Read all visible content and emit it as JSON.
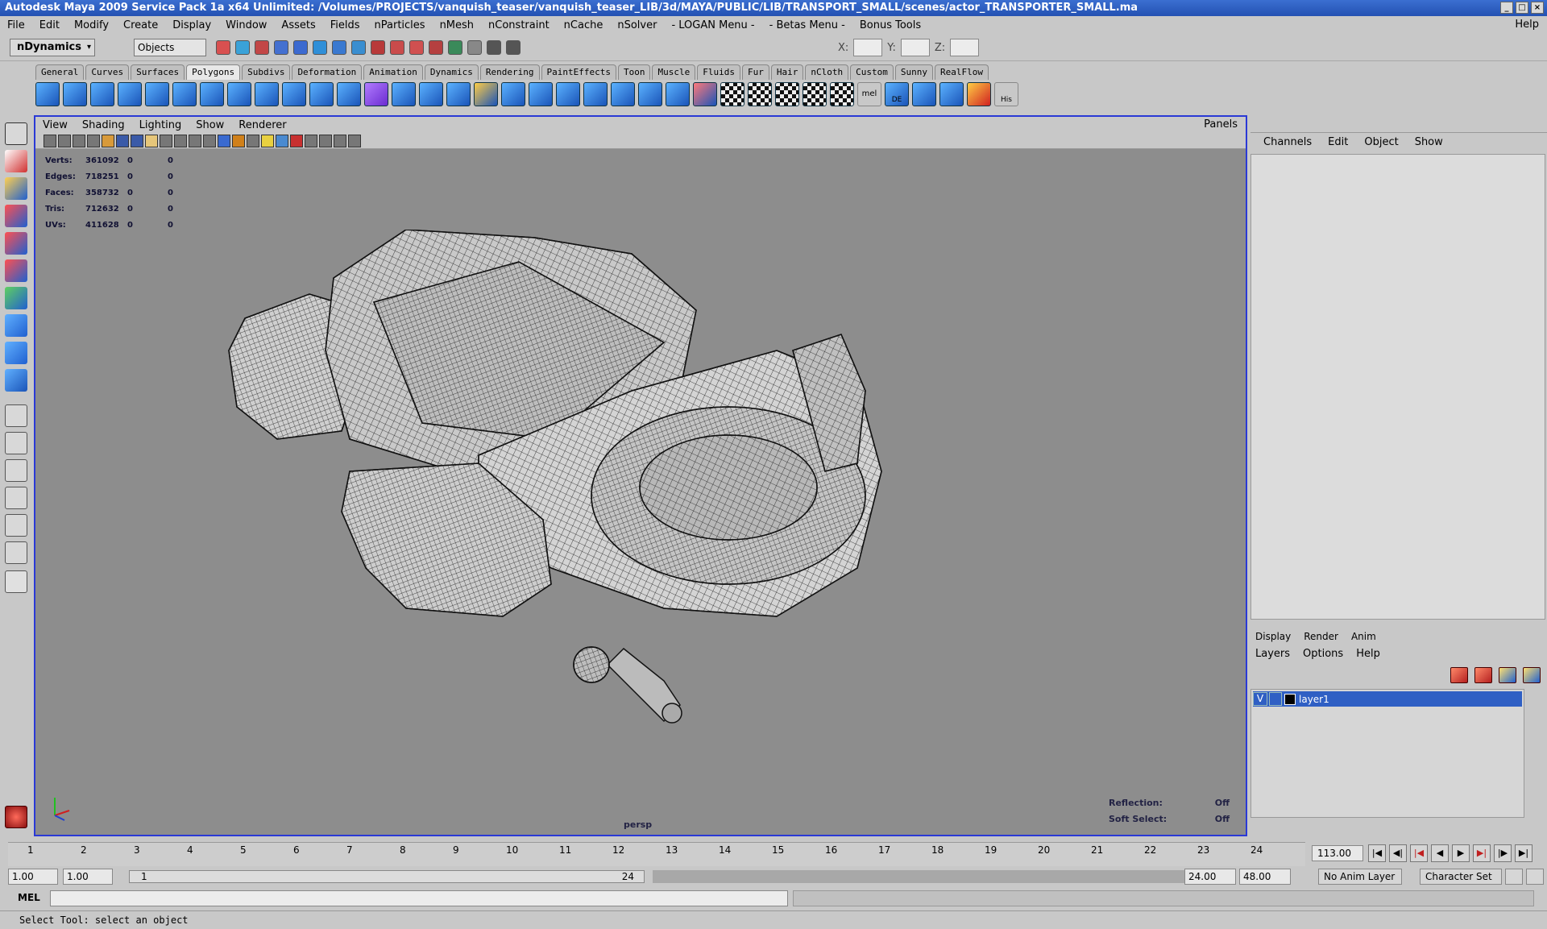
{
  "window": {
    "title": "Autodesk Maya 2009 Service Pack 1a x64 Unlimited: /Volumes/PROJECTS/vanquish_teaser/vanquish_teaser_LIB/3d/MAYA/PUBLIC/LIB/TRANSPORT_SMALL/scenes/actor_TRANSPORTER_SMALL.ma"
  },
  "menubar": {
    "items": [
      "File",
      "Edit",
      "Modify",
      "Create",
      "Display",
      "Window",
      "Assets",
      "Fields",
      "nParticles",
      "nMesh",
      "nConstraint",
      "nCache",
      "nSolver",
      "- LOGAN Menu -",
      "- Betas Menu -",
      "Bonus Tools"
    ],
    "help": "Help"
  },
  "status": {
    "mode": "nDynamics",
    "selection_mask": "Objects",
    "x_label": "X:",
    "y_label": "Y:",
    "z_label": "Z:"
  },
  "shelf": {
    "tabs": [
      "General",
      "Curves",
      "Surfaces",
      "Polygons",
      "Subdivs",
      "Deformation",
      "Animation",
      "Dynamics",
      "Rendering",
      "PaintEffects",
      "Toon",
      "Muscle",
      "Fluids",
      "Fur",
      "Hair",
      "nCloth",
      "Custom",
      "Sunny",
      "RealFlow"
    ],
    "active": "Polygons",
    "labels": {
      "mel": "mel",
      "de": "DE",
      "his": "His"
    }
  },
  "viewport": {
    "menu": [
      "View",
      "Shading",
      "Lighting",
      "Show",
      "Renderer"
    ],
    "panels": "Panels",
    "camera": "persp",
    "hud": [
      {
        "label": "Verts:",
        "value": "361092",
        "a": "0",
        "b": "0"
      },
      {
        "label": "Edges:",
        "value": "718251",
        "a": "0",
        "b": "0"
      },
      {
        "label": "Faces:",
        "value": "358732",
        "a": "0",
        "b": "0"
      },
      {
        "label": "Tris:",
        "value": "712632",
        "a": "0",
        "b": "0"
      },
      {
        "label": "UVs:",
        "value": "411628",
        "a": "0",
        "b": "0"
      }
    ],
    "hud_right": [
      {
        "label": "Reflection:",
        "value": "Off"
      },
      {
        "label": "Soft Select:",
        "value": "Off"
      }
    ]
  },
  "channelbox": {
    "menu": [
      "Channels",
      "Edit",
      "Object",
      "Show"
    ]
  },
  "layers": {
    "tabs": [
      "Display",
      "Render",
      "Anim"
    ],
    "menu": [
      "Layers",
      "Options",
      "Help"
    ],
    "row": {
      "visible": "V",
      "name": "layer1"
    },
    "colors": {
      "selected": "#2f5fc4"
    }
  },
  "time": {
    "ticks": [
      "1",
      "2",
      "3",
      "4",
      "5",
      "6",
      "7",
      "8",
      "9",
      "10",
      "11",
      "12",
      "13",
      "14",
      "15",
      "16",
      "17",
      "18",
      "19",
      "20",
      "21",
      "22",
      "23",
      "24"
    ],
    "current_frame": "113.00",
    "range_start": "1.00",
    "playback_start": "1.00",
    "range_inner_start": "1",
    "range_inner_end": "24",
    "playback_end": "24.00",
    "range_end": "48.00",
    "anim_layer": "No Anim Layer",
    "character_set": "Character Set"
  },
  "mel": {
    "label": "MEL"
  },
  "help_line": "Select Tool: select an object"
}
